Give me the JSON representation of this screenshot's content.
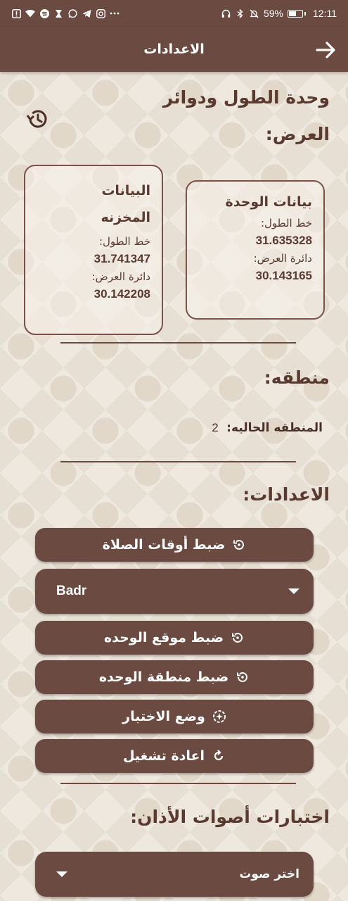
{
  "statusbar": {
    "battery": "59%",
    "time": "12:11",
    "battery_level": 0.59,
    "left_icons": [
      "alert-icon",
      "wifi-icon",
      "spotify-icon",
      "hourglass-icon",
      "whatsapp-icon",
      "telegram-icon",
      "instagram-icon",
      "more-icon"
    ],
    "right_icons": [
      "headphones-icon",
      "bluetooth-icon",
      "mute-icon",
      "battery-icon"
    ]
  },
  "appbar": {
    "title": "الاعدادات"
  },
  "coords_section": {
    "title_line1": "وحدة الطول ودوائر",
    "title_line2": "العرض:"
  },
  "unit_card": {
    "title": "بيانات الوحدة",
    "lon_label": "خط الطول:",
    "lon_value": "31.635328",
    "lat_label": "دائرة العرض:",
    "lat_value": "30.143165"
  },
  "stored_card": {
    "title_line1": "البيانات",
    "title_line2": "المخزنه",
    "lon_label": "خط الطول:",
    "lon_value": "31.741347",
    "lat_label": "دائرة العرض:",
    "lat_value": "30.142208"
  },
  "zone_section": {
    "title": "منطقه:",
    "current_label": "المنطقه الحاليه:",
    "current_value": "2"
  },
  "settings_section": {
    "title": "الاعدادات:",
    "prayer_button": "ضبط أوقات الصلاة",
    "dropdown_value": "Badr",
    "location_button": "ضبط موقع الوحده",
    "zone_button": "ضبط منطقة الوحده",
    "test_button": "وضع الاختبار",
    "restart_button": "اعادة تشغيل"
  },
  "adhan_section": {
    "title": "اختبارات أصوات الأذان:",
    "select_placeholder": "اختر صوت"
  },
  "colors": {
    "primary": "#6b4a42",
    "text": "#5a3a30",
    "background": "#ece6dd"
  }
}
